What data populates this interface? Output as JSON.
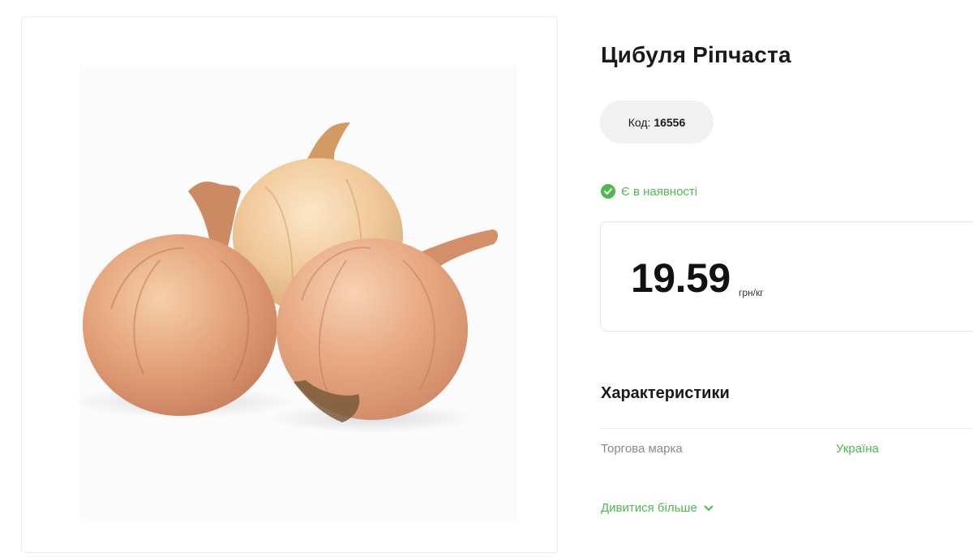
{
  "product": {
    "title": "Цибуля Ріпчаста",
    "code_label": "Код:",
    "code_value": "16556",
    "stock_text": "Є в наявності",
    "price": "19.59",
    "unit": "грн/кг",
    "image_alt": "onions-product-photo"
  },
  "specs": {
    "heading": "Характеристики",
    "rows": [
      {
        "label": "Торгова марка",
        "value": "Україна"
      }
    ],
    "more_label": "Дивитися більше"
  },
  "colors": {
    "accent": "#4fb94f",
    "pill_bg": "#f1f1f1",
    "border": "#e6e6e6"
  },
  "icons": {
    "stock": "check-circle-icon",
    "more": "chevron-down-icon"
  }
}
